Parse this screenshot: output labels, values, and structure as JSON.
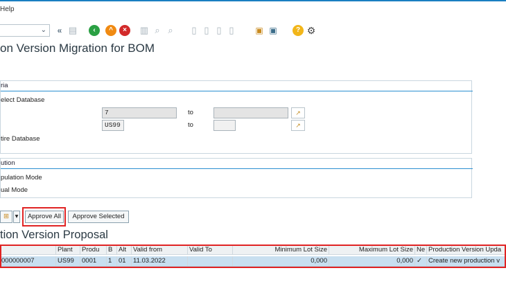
{
  "menu": {
    "help_label": "Help"
  },
  "toolbar": {
    "icons": [
      "chevron-down-icon",
      "double-left-icon",
      "save-icon",
      "back-icon",
      "exit-icon",
      "cancel-icon",
      "print-icon",
      "find-icon",
      "find-next-icon",
      "first-page-icon",
      "prev-page-icon",
      "next-page-icon",
      "last-page-icon",
      "new-session-icon",
      "shortcut-icon",
      "help-icon",
      "settings-icon"
    ]
  },
  "page": {
    "title": "on Version Migration for BOM"
  },
  "criteria": {
    "group_title": "ria",
    "select_db_label": "elect Database",
    "row1_value": "7",
    "row1_to": "to",
    "row2_value": "US99",
    "row2_to": "to",
    "entire_db_label": "tire Database"
  },
  "execution": {
    "group_title": "ution",
    "simulation_label": "pulation Mode",
    "manual_label": "ual Mode"
  },
  "buttons": {
    "approve_all": "Approve All",
    "approve_selected": "Approve Selected"
  },
  "proposal": {
    "title": "tion Version Proposal",
    "columns": [
      "Plant",
      "Produ",
      "B",
      "Alt",
      "Valid from",
      "Valid To",
      "Minimum Lot Size",
      "Maximum Lot Size",
      "Ne",
      "Production Version Upda"
    ],
    "rows": [
      {
        "id": "000000007",
        "plant": "US99",
        "prod": "0001",
        "b": "1",
        "alt": "01",
        "valid_from": "11.03.2022",
        "valid_to": "",
        "min_lot": "0,000",
        "max_lot": "0,000",
        "ne": "✓",
        "upd": "Create new production v"
      }
    ]
  },
  "colors": {
    "highlight": "#e02323",
    "accent": "#1a7fc1",
    "row_selected": "#c8dff0"
  }
}
